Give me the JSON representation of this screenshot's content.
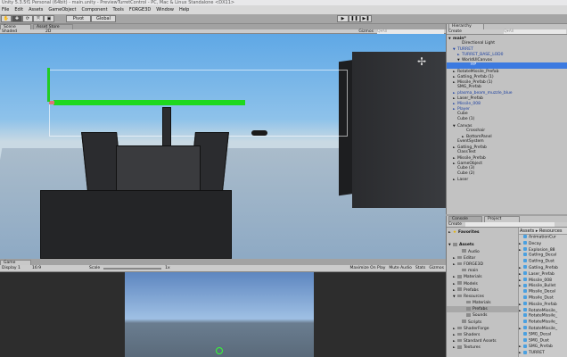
{
  "window": {
    "title": "Unity 5.3.5f1 Personal (64bit) - main.unity - PreviewTurretControl - PC, Mac & Linux Standalone <DX11>"
  },
  "menu": [
    "File",
    "Edit",
    "Assets",
    "GameObject",
    "Component",
    "Tools",
    "FORGE3D",
    "Window",
    "Help"
  ],
  "toolbar": {
    "pivot": "Pivot",
    "global": "Global",
    "play": "▶",
    "pause": "❚❚",
    "step": "▶❚"
  },
  "scene": {
    "tabs": [
      "Scene",
      "Asset Store"
    ],
    "shading": "Shaded",
    "mode_2d": "2D",
    "gizmos": "Gizmos",
    "search_placeholder": "Q▾All"
  },
  "game": {
    "tab": "Game",
    "display": "Display 1",
    "aspect": "16:9",
    "scale_label": "Scale",
    "scale_value": "1x",
    "buttons": [
      "Maximize On Play",
      "Mute Audio",
      "Stats",
      "Gizmos"
    ]
  },
  "hierarchy": {
    "tab": "Hierarchy",
    "create": "Create",
    "search_placeholder": "Q▾All",
    "items": [
      {
        "label": "main*",
        "indent": 0,
        "arrow": "▼",
        "style": "bold"
      },
      {
        "label": "Directional Light",
        "indent": 2
      },
      {
        "label": "TURRET",
        "indent": 1,
        "arrow": "▼",
        "style": "blue"
      },
      {
        "label": "TURRET_BASE_LOD0",
        "indent": 2,
        "arrow": "►",
        "style": "blue"
      },
      {
        "label": "WorldUICanvas",
        "indent": 2,
        "arrow": "▼"
      },
      {
        "label": "HP",
        "indent": 4,
        "style": "sel"
      },
      {
        "label": "RotateMissile_Prefab",
        "indent": 1,
        "arrow": "►"
      },
      {
        "label": "Gatling_Prefab (1)",
        "indent": 1,
        "arrow": "►"
      },
      {
        "label": "Missile_Prefab (1)",
        "indent": 1,
        "arrow": "►"
      },
      {
        "label": "SMG_Prefab",
        "indent": 1
      },
      {
        "label": "plasma_beam_muzzle_blue",
        "indent": 1,
        "arrow": "►",
        "style": "blue"
      },
      {
        "label": "Laser_Prefab",
        "indent": 1,
        "arrow": "►"
      },
      {
        "label": "Missile_008",
        "indent": 1,
        "arrow": "►",
        "style": "blue"
      },
      {
        "label": "Player",
        "indent": 1,
        "arrow": "►",
        "style": "blue"
      },
      {
        "label": "Cube",
        "indent": 1
      },
      {
        "label": "Cube (1)",
        "indent": 1
      },
      {
        "label": "Canvas",
        "indent": 1,
        "arrow": "▼"
      },
      {
        "label": "Crosshair",
        "indent": 3
      },
      {
        "label": "BottomPanel",
        "indent": 3,
        "arrow": "►"
      },
      {
        "label": "EventSystem",
        "indent": 1
      },
      {
        "label": "Gatling_Prefab",
        "indent": 1,
        "arrow": "►"
      },
      {
        "label": "ClassTest",
        "indent": 1
      },
      {
        "label": "Missile_Prefab",
        "indent": 1,
        "arrow": "►"
      },
      {
        "label": "GameObject",
        "indent": 1,
        "arrow": "►"
      },
      {
        "label": "Cube (3)",
        "indent": 1
      },
      {
        "label": "Cube (2)",
        "indent": 1
      },
      {
        "label": "Laser",
        "indent": 1,
        "arrow": "►"
      }
    ]
  },
  "project": {
    "tabs": [
      "Console",
      "Project"
    ],
    "create": "Create",
    "breadcrumb": "Assets ▸ Resources",
    "tree": [
      {
        "label": "Favorites",
        "indent": 0,
        "arrow": "►",
        "icon": "star"
      },
      {
        "label": "",
        "indent": 0
      },
      {
        "label": "Assets",
        "indent": 0,
        "arrow": "▼",
        "icon": "folder"
      },
      {
        "label": "Audio",
        "indent": 2,
        "icon": "folder"
      },
      {
        "label": "Editor",
        "indent": 1,
        "arrow": "►",
        "icon": "folder"
      },
      {
        "label": "FORGE3D",
        "indent": 1,
        "arrow": "►",
        "icon": "folder"
      },
      {
        "label": "main",
        "indent": 2,
        "icon": "folder"
      },
      {
        "label": "Materials",
        "indent": 1,
        "arrow": "►",
        "icon": "folder"
      },
      {
        "label": "Models",
        "indent": 1,
        "arrow": "►",
        "icon": "folder"
      },
      {
        "label": "Prefabs",
        "indent": 1,
        "arrow": "►",
        "icon": "folder"
      },
      {
        "label": "Resources",
        "indent": 1,
        "arrow": "▼",
        "icon": "folder"
      },
      {
        "label": "Materials",
        "indent": 3,
        "icon": "folder"
      },
      {
        "label": "Prefabs",
        "indent": 3,
        "icon": "folder",
        "selected": true
      },
      {
        "label": "Sounds",
        "indent": 3,
        "icon": "folder"
      },
      {
        "label": "Scripts",
        "indent": 2,
        "icon": "folder"
      },
      {
        "label": "ShaderForge",
        "indent": 1,
        "arrow": "►",
        "icon": "folder"
      },
      {
        "label": "Shaders",
        "indent": 1,
        "arrow": "►",
        "icon": "folder"
      },
      {
        "label": "Standard Assets",
        "indent": 1,
        "arrow": "►",
        "icon": "folder"
      },
      {
        "label": "Textures",
        "indent": 1,
        "arrow": "►",
        "icon": "folder"
      }
    ],
    "files": [
      "AnimationCur",
      "Decay",
      "Explosion_88",
      "Gatling_Decal",
      "Gatling_Dust",
      "Gatling_Prefab",
      "Laser_Prefab",
      "Missile_008",
      "Missile_Bullet",
      "Missile_Decal",
      "Missile_Dust",
      "Missile_Prefab",
      "RotateMissile_",
      "RotateMissile_",
      "RotateMissile_",
      "RotateMissile_",
      "SMG_Decal",
      "SMG_Dust",
      "SMG_Prefab",
      "TURRET"
    ],
    "file_arrows": [
      false,
      true,
      true,
      false,
      false,
      true,
      true,
      true,
      true,
      false,
      false,
      true,
      true,
      false,
      false,
      true,
      false,
      false,
      true,
      true
    ]
  },
  "colors": {
    "selection": "#3c7ae0",
    "health_bar": "#1fd81f",
    "prefab_blue": "#1b3fa0"
  }
}
